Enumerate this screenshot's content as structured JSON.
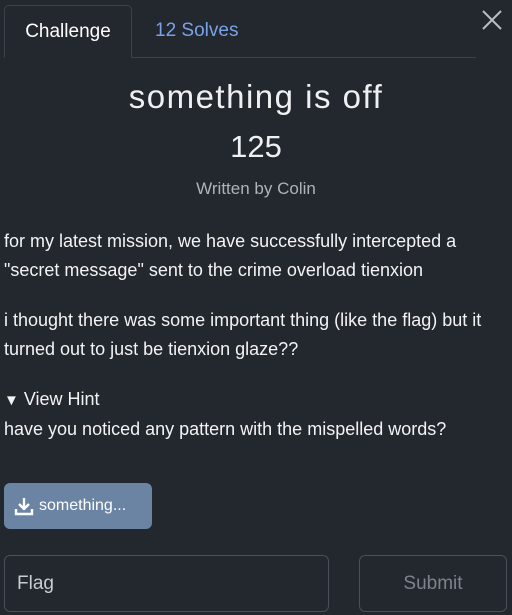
{
  "tabs": [
    {
      "label": "Challenge",
      "active": true
    },
    {
      "label": "12 Solves",
      "active": false
    }
  ],
  "close_icon": "close-icon",
  "challenge": {
    "name": "something is off",
    "value": "125",
    "author": "Written by Colin",
    "description": [
      "for my latest mission, we have successfully intercepted a \"secret message\" sent to the crime overload tienxion",
      "i thought there was some important thing (like the flag) but it turned out to just be tienxion glaze??"
    ],
    "hint": {
      "toggle_label": "View Hint",
      "arrow": "▼",
      "text": "have you noticed any pattern with the mispelled words?"
    },
    "file": {
      "label": "something...",
      "icon": "download-icon"
    }
  },
  "form": {
    "flag_placeholder": "Flag",
    "submit_label": "Submit"
  },
  "colors": {
    "background": "#23272e",
    "tab_link": "#7aa2e8",
    "file_button": "#6c84a4"
  }
}
